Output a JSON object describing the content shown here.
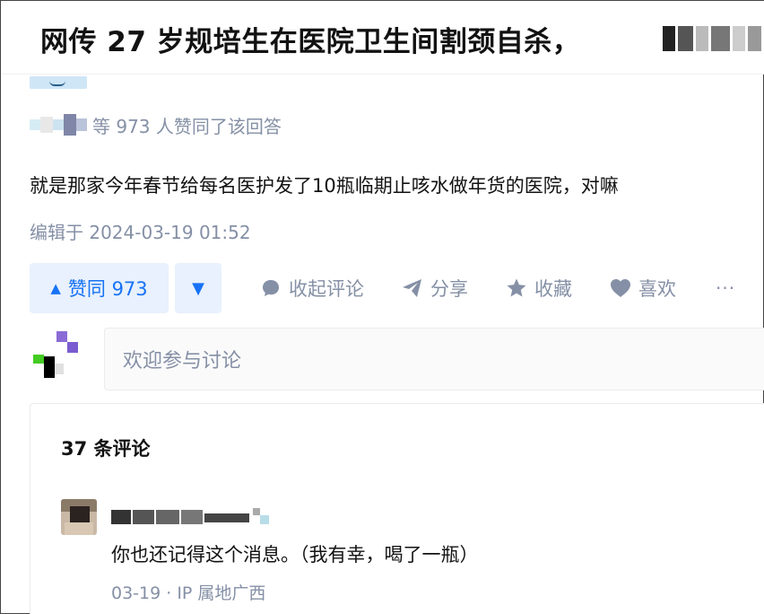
{
  "question": {
    "title": "网传 27 岁规培生在医院卫生间割颈自杀，"
  },
  "answer": {
    "voters_text": "等 973 人赞同了该回答",
    "body": "就是那家今年春节给每名医护发了10瓶临期止咳水做年货的医院，对嘛",
    "edited_time": "编辑于 2024-03-19 01:52"
  },
  "actions": {
    "upvote_arrow": "▲",
    "upvote_label": "赞同 973",
    "downvote_arrow": "▼",
    "collapse_comments": "收起评论",
    "share": "分享",
    "favorite": "收藏",
    "like": "喜欢",
    "more": "···",
    "icons": [
      "comment-icon",
      "share-icon",
      "star-icon",
      "heart-icon"
    ]
  },
  "comment_box": {
    "placeholder": "欢迎参与讨论"
  },
  "comments": {
    "count_label": "37 条评论",
    "items": [
      {
        "text": "你也还记得这个消息。（我有幸，喝了一瓶）",
        "meta": "03-19 · IP 属地广西"
      }
    ]
  },
  "colors": {
    "accent": "#1772f6",
    "accent_bg": "#e8f1fd",
    "muted": "#8590a6",
    "text": "#121212"
  }
}
